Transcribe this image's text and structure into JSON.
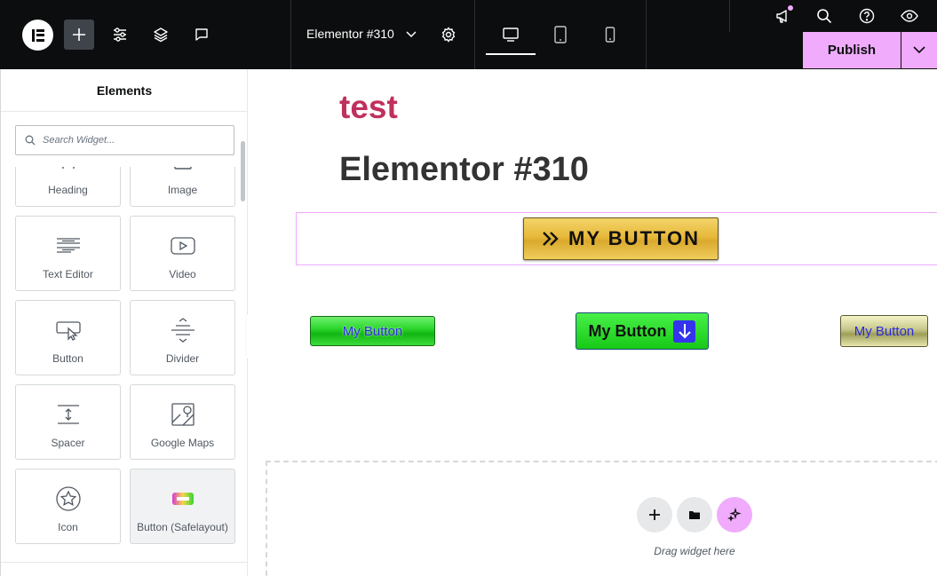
{
  "topbar": {
    "document_title": "Elementor #310",
    "publish_label": "Publish",
    "icons": [
      "elementor-logo-icon",
      "add-icon",
      "site-settings-icon",
      "structure-icon",
      "notes-icon",
      "chevron-down-icon",
      "gear-icon",
      "desktop-icon",
      "tablet-icon",
      "mobile-icon",
      "whats-new-icon",
      "search-icon",
      "help-icon",
      "preview-icon"
    ],
    "colors": {
      "bar": "#0c0d0e",
      "publish": "#f0abfc"
    }
  },
  "panel": {
    "title": "Elements",
    "search_placeholder": "Search Widget...",
    "widgets": [
      {
        "label": "Heading",
        "icon": "heading-icon"
      },
      {
        "label": "Image",
        "icon": "image-icon"
      },
      {
        "label": "Text Editor",
        "icon": "text-editor-icon"
      },
      {
        "label": "Video",
        "icon": "video-icon"
      },
      {
        "label": "Button",
        "icon": "button-icon"
      },
      {
        "label": "Divider",
        "icon": "divider-icon"
      },
      {
        "label": "Spacer",
        "icon": "spacer-icon"
      },
      {
        "label": "Google Maps",
        "icon": "google-maps-icon"
      },
      {
        "label": "Icon",
        "icon": "star-icon"
      },
      {
        "label": "Button (Safelayout)",
        "icon": "safelayout-button-icon"
      }
    ]
  },
  "canvas": {
    "site_text": "test",
    "page_heading": "Elementor #310",
    "gold_button_label": "MY BUTTON",
    "green_button_label": "My Button",
    "download_button_label": "My Button",
    "olive_button_label": "My Button",
    "drop_zone_text": "Drag widget here",
    "colors": {
      "site_text": "#c0305c",
      "heading": "#333333",
      "selection": "#f0abfc",
      "ai_button": "#f0abfc"
    }
  }
}
